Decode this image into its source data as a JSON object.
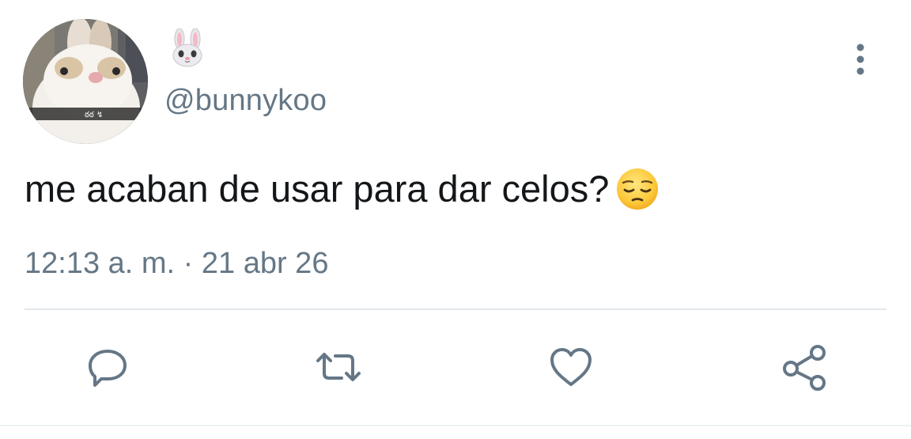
{
  "tweet": {
    "display_name_icon": "rabbit-face-emoji",
    "handle": "@bunnykoo",
    "text": "me acaban de usar para dar celos?",
    "text_emoji": "pensive-face-emoji",
    "timestamp": "12:13 a. m. · 21 abr 26"
  },
  "actions": {
    "reply_icon": "reply-icon",
    "retweet_icon": "retweet-icon",
    "like_icon": "heart-icon",
    "share_icon": "share-icon"
  },
  "colors": {
    "secondary_text": "#657786",
    "icon": "#657786",
    "divider": "#e1e8ed",
    "primary_text": "#14171a"
  }
}
